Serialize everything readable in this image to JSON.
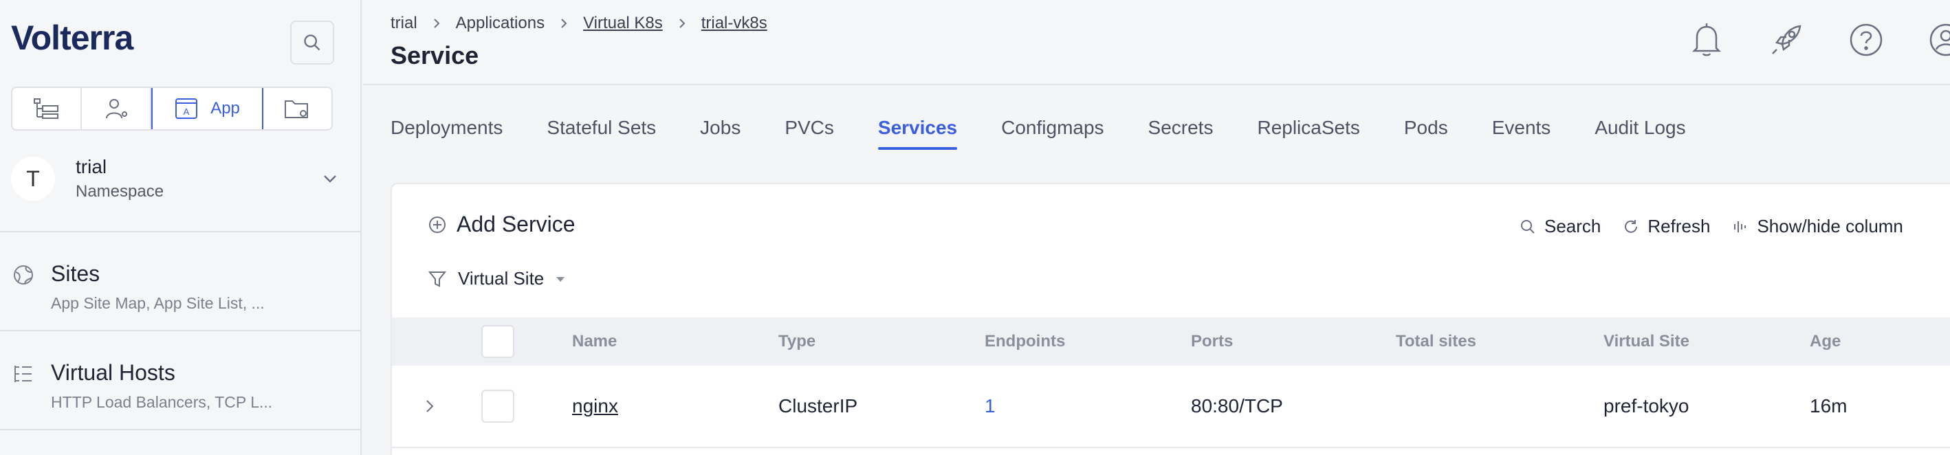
{
  "brand": {
    "logo_text": "Volterra"
  },
  "sidebar": {
    "workspace_tabs": [
      {
        "icon": "hierarchy-icon",
        "label": ""
      },
      {
        "icon": "user-share-icon",
        "label": ""
      },
      {
        "icon": "app-icon",
        "label": "App",
        "active": true
      },
      {
        "icon": "folder-gear-icon",
        "label": ""
      }
    ],
    "namespace": {
      "initial": "T",
      "name": "trial",
      "subtitle": "Namespace"
    },
    "nav": [
      {
        "icon": "globe-icon",
        "title": "Sites",
        "subtitle": "App Site Map, App Site List, ..."
      },
      {
        "icon": "list-tree-icon",
        "title": "Virtual Hosts",
        "subtitle": "HTTP Load Balancers, TCP L..."
      }
    ]
  },
  "header": {
    "breadcrumb": [
      {
        "label": "trial",
        "link": false
      },
      {
        "label": "Applications",
        "link": false
      },
      {
        "label": "Virtual K8s",
        "link": true
      },
      {
        "label": "trial-vk8s",
        "link": true
      }
    ],
    "title": "Service",
    "icons": [
      "bell-icon",
      "rocket-icon",
      "help-icon",
      "user-icon"
    ]
  },
  "tabs": [
    "Deployments",
    "Stateful Sets",
    "Jobs",
    "PVCs",
    "Services",
    "Configmaps",
    "Secrets",
    "ReplicaSets",
    "Pods",
    "Events",
    "Audit Logs"
  ],
  "active_tab": "Services",
  "toolbar": {
    "add_label": "Add Service",
    "search_label": "Search",
    "refresh_label": "Refresh",
    "columns_label": "Show/hide column",
    "filter_label": "Virtual Site"
  },
  "table": {
    "columns": [
      "Name",
      "Type",
      "Endpoints",
      "Ports",
      "Total sites",
      "Virtual Site",
      "Age"
    ],
    "rows": [
      {
        "name": "nginx",
        "type": "ClusterIP",
        "endpoints": "1",
        "ports": "80:80/TCP",
        "total_sites": "",
        "virtual_site": "pref-tokyo",
        "age": "16m"
      }
    ]
  },
  "colors": {
    "accent": "#3a5ee0",
    "brand": "#1b2a5c"
  }
}
